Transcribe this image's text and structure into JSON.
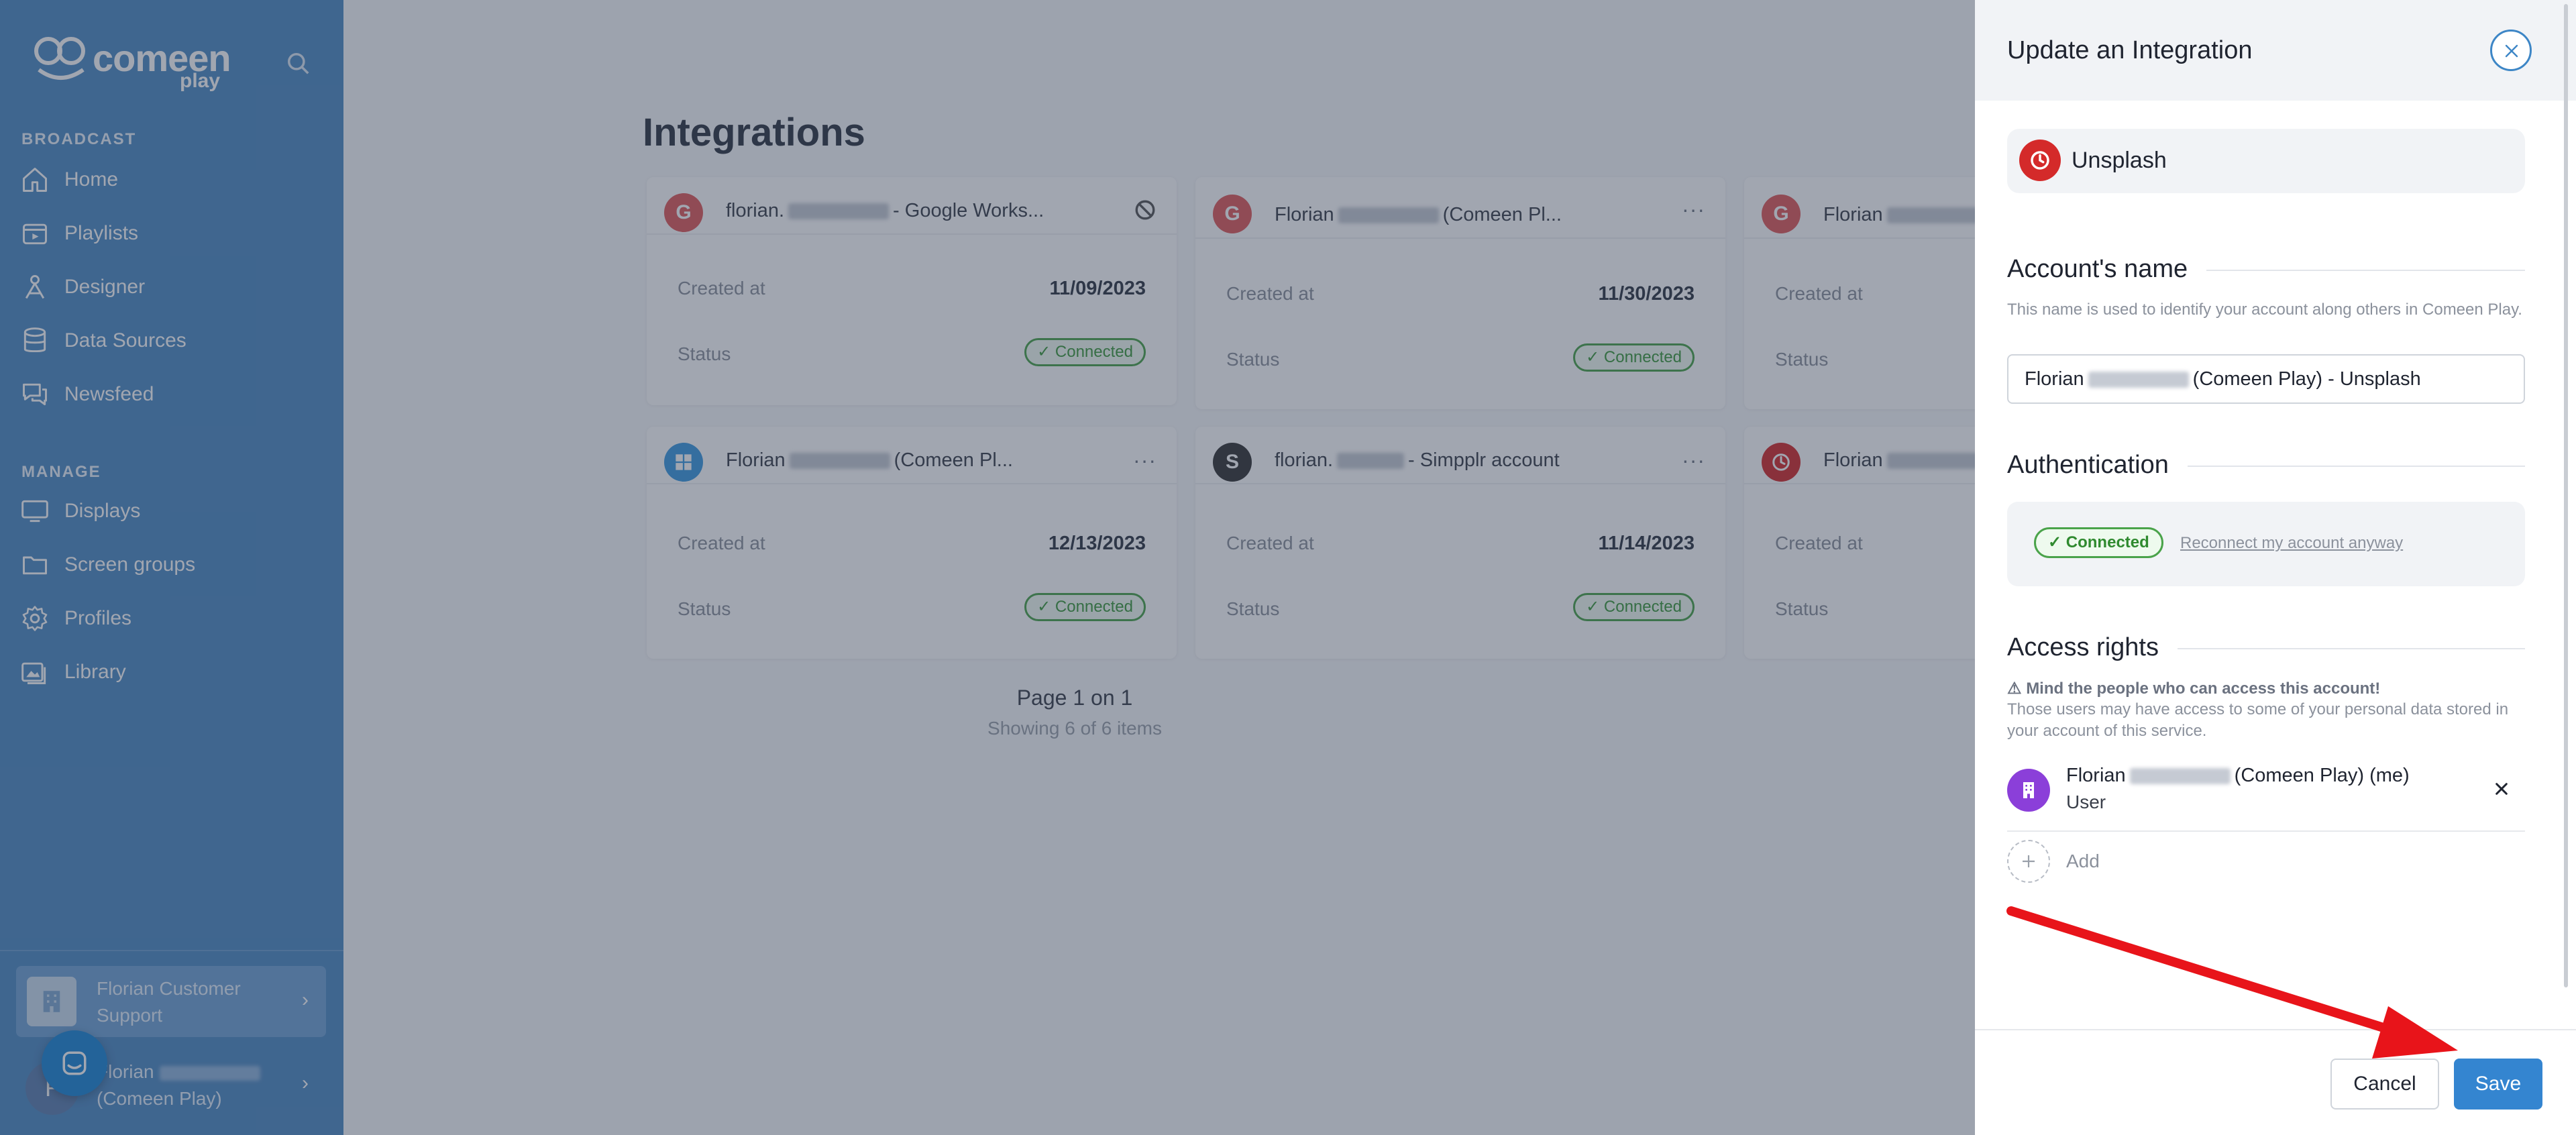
{
  "sidebar": {
    "brand": "comeen",
    "brand_sub": "play",
    "broadcast_label": "BROADCAST",
    "broadcast_items": [
      {
        "label": "Home",
        "icon": "home-icon"
      },
      {
        "label": "Playlists",
        "icon": "playlist-icon"
      },
      {
        "label": "Designer",
        "icon": "designer-icon"
      },
      {
        "label": "Data Sources",
        "icon": "database-icon"
      },
      {
        "label": "Newsfeed",
        "icon": "newsfeed-icon"
      }
    ],
    "manage_label": "MANAGE",
    "manage_items": [
      {
        "label": "Displays",
        "icon": "monitor-icon"
      },
      {
        "label": "Screen groups",
        "icon": "folder-icon"
      },
      {
        "label": "Profiles",
        "icon": "gear-icon"
      },
      {
        "label": "Library",
        "icon": "library-icon"
      }
    ],
    "customer": "Florian Customer Support",
    "user_first": "Florian",
    "user_org": "(Comeen Play)",
    "user_initial": "F"
  },
  "main": {
    "title": "Integrations",
    "cards": [
      {
        "avatar": "G",
        "name_a": "florian.",
        "name_b": "- Google Works...",
        "created_label": "Created at",
        "created": "11/09/2023",
        "status_label": "Status",
        "status": "Connected",
        "action": "⃠"
      },
      {
        "avatar": "G",
        "name_a": "Florian",
        "name_b": "(Comeen Pl...",
        "created_label": "Created at",
        "created": "11/30/2023",
        "status_label": "Status",
        "status": "Connected",
        "action": "···"
      },
      {
        "avatar": "G",
        "name_a": "Florian",
        "name_b": "",
        "created_label": "Created at",
        "created": "",
        "status_label": "Status",
        "status": "",
        "action": ""
      },
      {
        "avatar": "",
        "name_a": "Florian",
        "name_b": "(Comeen Pl...",
        "created_label": "Created at",
        "created": "12/13/2023",
        "status_label": "Status",
        "status": "Connected",
        "action": "···"
      },
      {
        "avatar": "S",
        "name_a": "florian.",
        "name_b": "- Simpplr account",
        "created_label": "Created at",
        "created": "11/14/2023",
        "status_label": "Status",
        "status": "Connected",
        "action": "···"
      },
      {
        "avatar": "",
        "name_a": "Florian",
        "name_b": "",
        "created_label": "Created at",
        "created": "",
        "status_label": "Status",
        "status": "",
        "action": ""
      }
    ],
    "pagination": "Page 1 on 1",
    "showing": "Showing 6 of 6 items"
  },
  "panel": {
    "title": "Update an Integration",
    "provider": "Unsplash",
    "account_heading": "Account's name",
    "account_hint": "This name is used to identify your account along others in Comeen Play.",
    "account_value_a": "Florian",
    "account_value_b": "(Comeen Play) - Unsplash",
    "auth_heading": "Authentication",
    "auth_status": "Connected",
    "auth_reconnect": "Reconnect my account anyway",
    "access_heading": "Access rights",
    "warning_title": "Mind the people who can access this account!",
    "warning_text": "Those users may have access to some of your personal data stored in your account of this service.",
    "user_name_a": "Florian",
    "user_name_b": "(Comeen Play) (me)",
    "user_role": "User",
    "add_label": "Add",
    "cancel_label": "Cancel",
    "save_label": "Save"
  },
  "colors": {
    "sidebar": "#4e8ac3",
    "accent": "#3485d0",
    "connected": "#4aa34a",
    "unsplash": "#d42a2a",
    "google": "#e35d5d",
    "arrow": "#e8141a"
  }
}
